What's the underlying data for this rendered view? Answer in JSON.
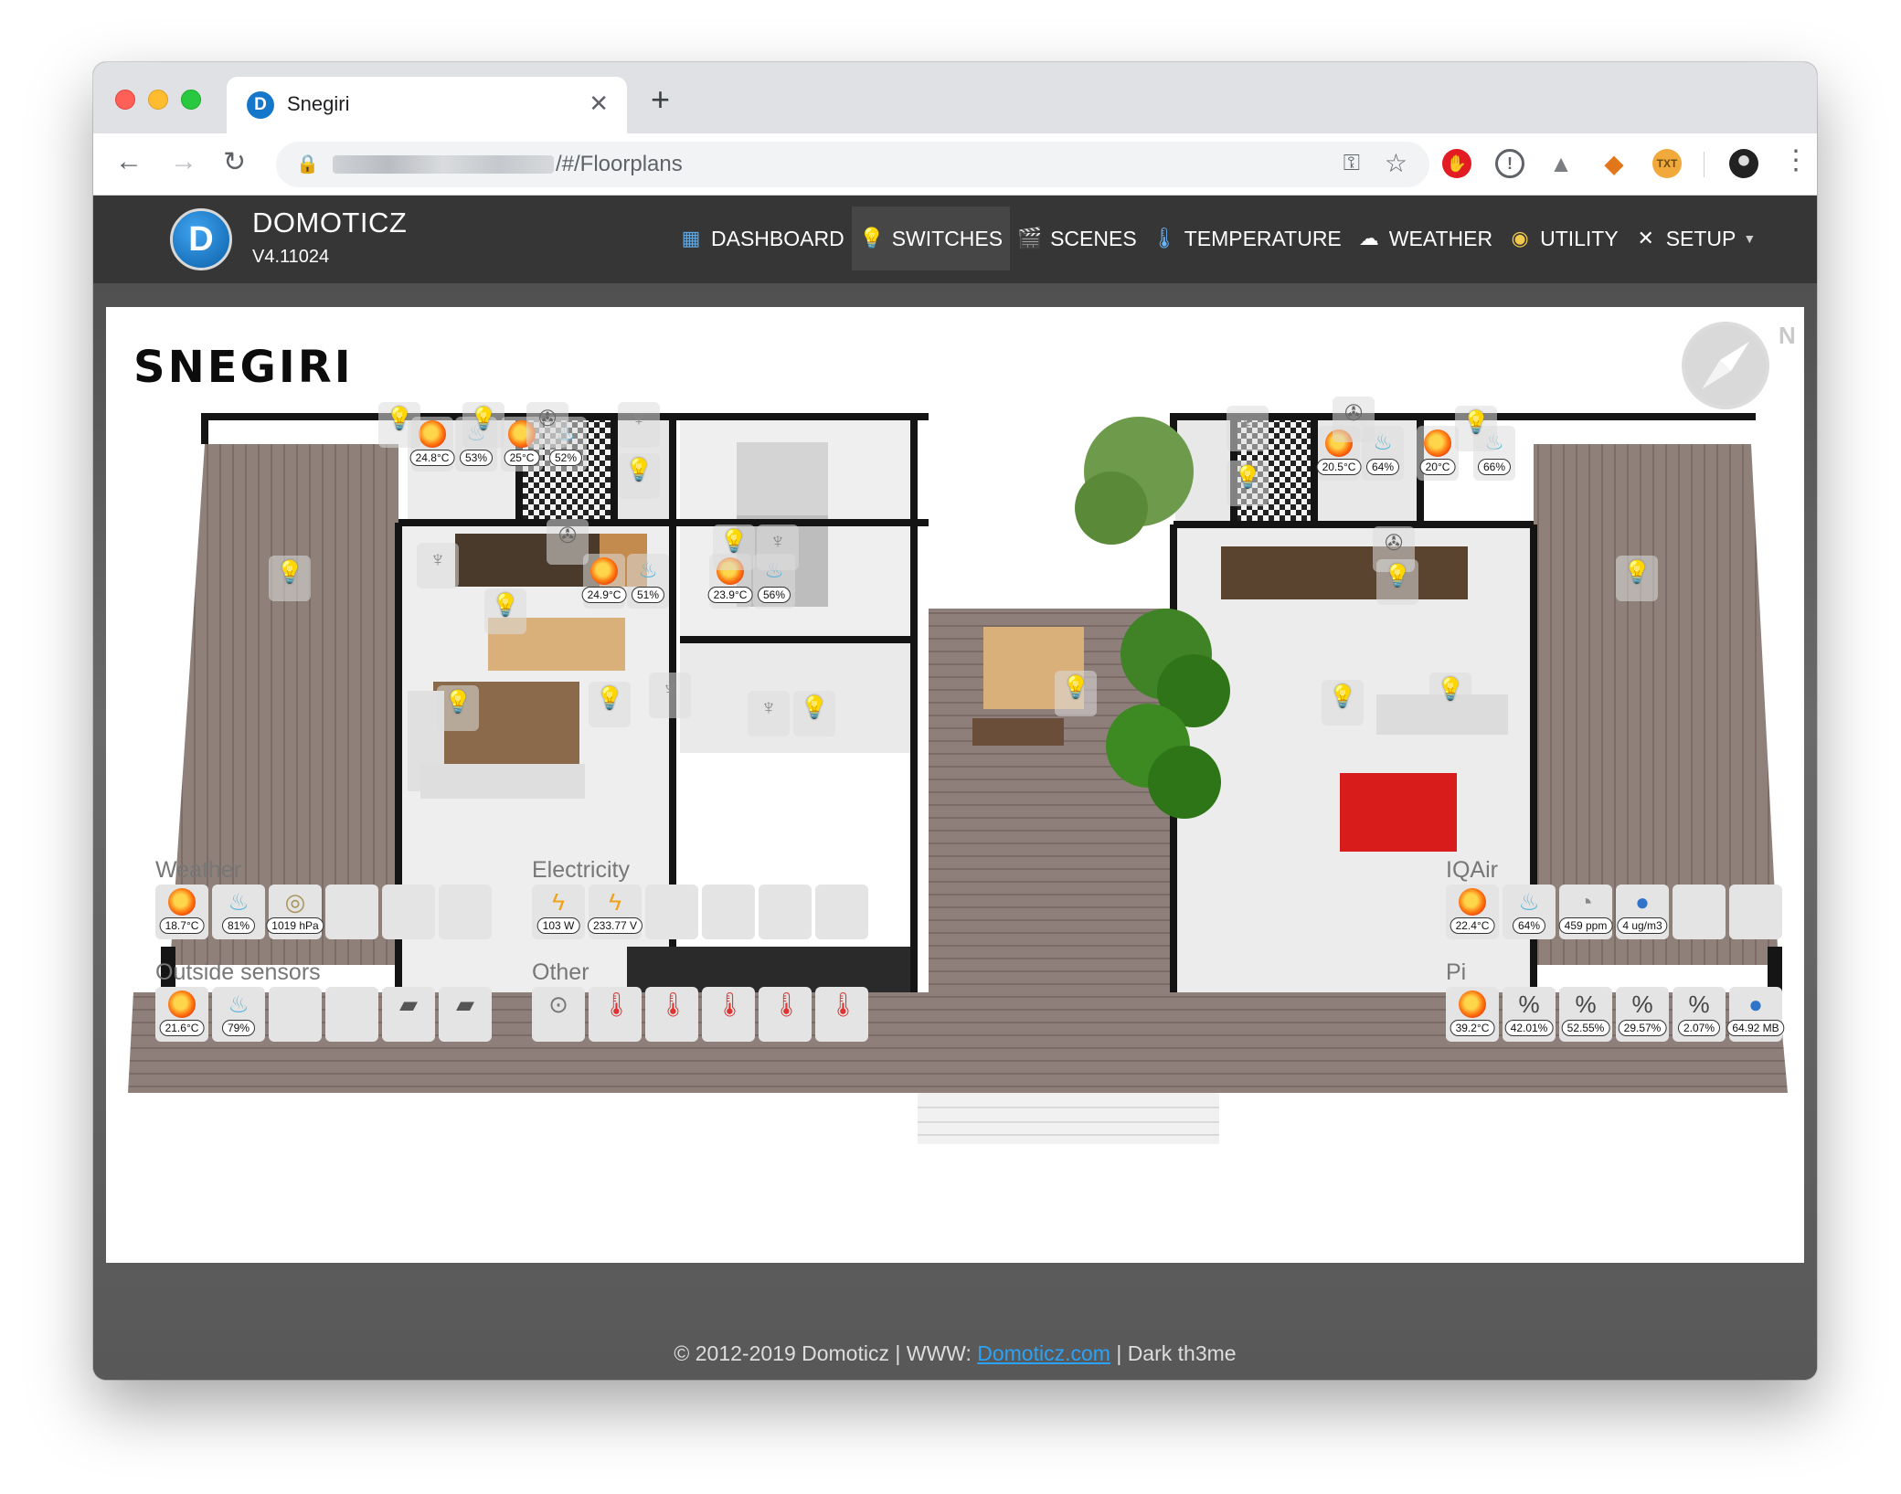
{
  "browser": {
    "tab_title": "Snegiri",
    "url_suffix": "/#/Floorplans",
    "new_tab": "+",
    "tab_close": "✕"
  },
  "app": {
    "brand_name": "DOMOTICZ",
    "version": "V4.11024",
    "nav": [
      {
        "label": "DASHBOARD",
        "icon": "dashboard-icon"
      },
      {
        "label": "SWITCHES",
        "icon": "lightbulb-icon"
      },
      {
        "label": "SCENES",
        "icon": "clapperboard-icon"
      },
      {
        "label": "TEMPERATURE",
        "icon": "thermometer-icon"
      },
      {
        "label": "WEATHER",
        "icon": "cloud-icon"
      },
      {
        "label": "UTILITY",
        "icon": "globe-icon"
      },
      {
        "label": "SETUP",
        "icon": "tools-icon"
      }
    ]
  },
  "floorplan": {
    "title": "SNEGIRI",
    "compass_label": "N",
    "room_sensors": [
      {
        "label": "24.8°C",
        "kind": "temperature"
      },
      {
        "label": "53%",
        "kind": "humidity"
      },
      {
        "label": "25°C",
        "kind": "temperature"
      },
      {
        "label": "52%",
        "kind": "humidity"
      },
      {
        "label": "24.9°C",
        "kind": "temperature"
      },
      {
        "label": "51%",
        "kind": "humidity"
      },
      {
        "label": "23.9°C",
        "kind": "temperature"
      },
      {
        "label": "56%",
        "kind": "humidity"
      },
      {
        "label": "20.5°C",
        "kind": "temperature"
      },
      {
        "label": "64%",
        "kind": "humidity"
      },
      {
        "label": "20°C",
        "kind": "temperature"
      },
      {
        "label": "66%",
        "kind": "humidity"
      }
    ]
  },
  "groups": {
    "weather": {
      "title": "Weather",
      "tiles": [
        "18.7°C",
        "81%",
        "1019 hPa"
      ]
    },
    "electricity": {
      "title": "Electricity",
      "tiles": [
        "103 W",
        "233.77 V"
      ]
    },
    "iqair": {
      "title": "IQAir",
      "tiles": [
        "22.4°C",
        "64%",
        "459 ppm",
        "4 ug/m3"
      ]
    },
    "outside": {
      "title": "Outside sensors",
      "tiles": [
        "21.6°C",
        "79%"
      ]
    },
    "other": {
      "title": "Other"
    },
    "pi": {
      "title": "Pi",
      "tiles": [
        "39.2°C",
        "42.01%",
        "52.55%",
        "29.57%",
        "2.07%",
        "64.92 MB"
      ]
    }
  },
  "footer": {
    "prefix": "© 2012-2019 Domoticz | WWW: ",
    "link": "Domoticz.com",
    "suffix": " | Dark th3me"
  },
  "colors": {
    "header_bg": "#363636",
    "link": "#2aa2f5",
    "logo": "#1577c9"
  }
}
